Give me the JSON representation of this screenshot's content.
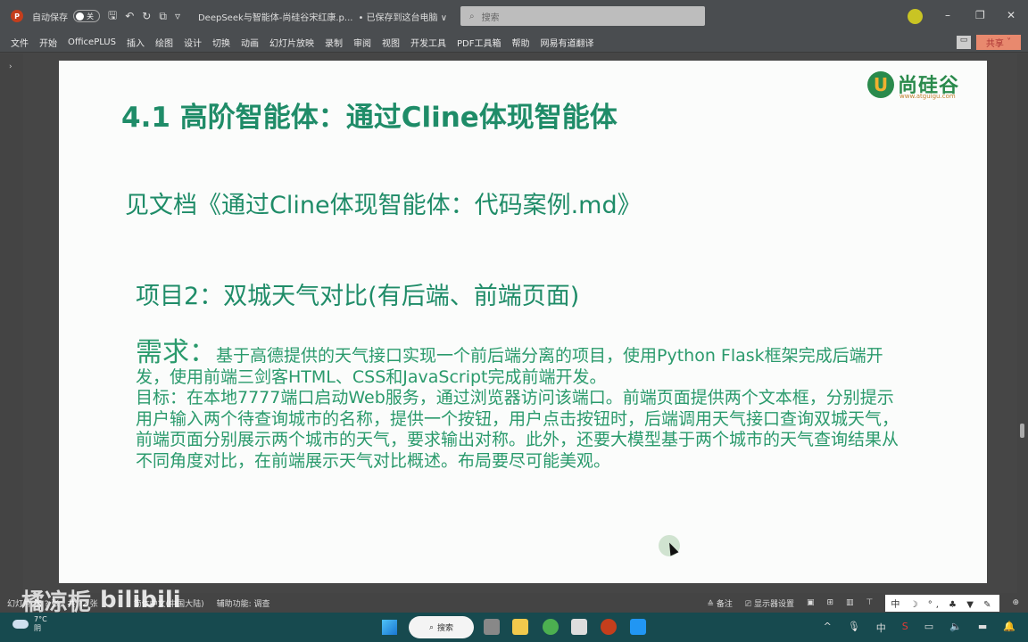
{
  "titlebar": {
    "autosave": "自动保存",
    "toggle": "关",
    "filename": "DeepSeek与智能体-尚硅谷宋红康.p...",
    "saved": "• 已保存到这台电脑 ∨",
    "search_placeholder": "搜索"
  },
  "menu": [
    "文件",
    "开始",
    "OfficePLUS",
    "插入",
    "绘图",
    "设计",
    "切换",
    "动画",
    "幻灯片放映",
    "录制",
    "审阅",
    "视图",
    "开发工具",
    "PDF工具箱",
    "帮助",
    "网易有道翻译"
  ],
  "share": "共享",
  "slide": {
    "title": "4.1 高阶智能体：通过Cline体现智能体",
    "logo_name": "尚硅谷",
    "logo_url": "www.atguigu.com",
    "doc_ref": "见文档《通过Cline体现智能体：代码案例.md》",
    "project": "项目2：双城天气对比(有后端、前端页面)",
    "req_label": "需求：",
    "req_text": "基于高德提供的天气接口实现一个前后端分离的项目，使用Python Flask框架完成后端开发，使用前端三剑客HTML、CSS和JavaScript完成前端开发。",
    "goal_text": "目标：在本地7777端口启动Web服务，通过浏览器访问该端口。前端页面提供两个文本框，分别提示用户输入两个待查询城市的名称，提供一个按钮，用户点击按钮时，后端调用天气接口查询双城天气，前端页面分别展示两个城市的天气，要求输出对称。此外，还要大模型基于两个城市的天气查询结果从不同角度对比，在前端展示天气对比概述。布局要尽可能美观。"
  },
  "status": {
    "slide_info": "幻灯片 第 ? 张，共 ?2 张",
    "language": "简体中文(中国大陆)",
    "accessibility": "辅助功能: 调查",
    "notes": "备注",
    "display": "显示器设置",
    "ime": "中 ☽ °, ♣ ▼ ✎"
  },
  "taskbar": {
    "temp": "7°C",
    "weather": "阴",
    "search": "搜索",
    "ime": "中"
  },
  "watermark": {
    "user": "橘凉栀",
    "brand": "bilibili"
  }
}
